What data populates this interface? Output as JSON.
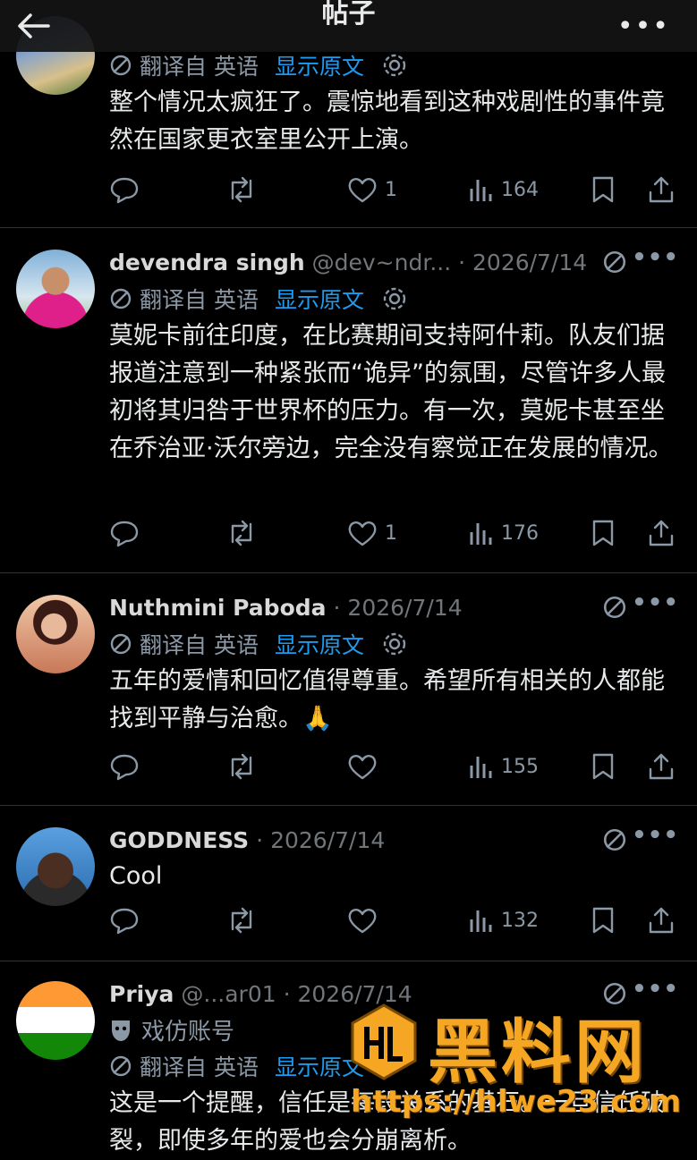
{
  "header": {
    "title": "帖子",
    "more_label": "•••"
  },
  "translate": {
    "label": "翻译自 英语",
    "show_original": "显示原文"
  },
  "posts": [
    {
      "name": "",
      "handle": "",
      "text": "整个情况太疯狂了。震惊地看到这种戏剧性的事件竟然在国家更衣室里公开上演。",
      "likes": "1",
      "views": "164"
    },
    {
      "name": "devendra singh",
      "handle": "@dev~ndr... · 2026/7/14",
      "text": "莫妮卡前往印度，在比赛期间支持阿什莉。队友们据报道注意到一种紧张而“诡异”的氛围，尽管许多人最初将其归咎于世界杯的压力。有一次，莫妮卡甚至坐在乔治亚·沃尔旁边，完全没有察觉正在发展的情况。",
      "likes": "1",
      "views": "176"
    },
    {
      "name": "Nuthmini Paboda",
      "handle": "· 2026/7/14",
      "text": "五年的爱情和回忆值得尊重。希望所有相关的人都能找到平静与治愈。🙏",
      "likes": "",
      "views": "155"
    },
    {
      "name": "GODDNESS",
      "handle": "· 2026/7/14",
      "text": "Cool",
      "likes": "",
      "views": "132"
    },
    {
      "name": "Priya",
      "handle": "@...ar01 · 2026/7/14",
      "parody": "戏仿账号",
      "text": "这是一个提醒，信任是每段关系的基石。一旦信任破裂，即使多年的爱也会分崩离析。",
      "likes": "",
      "views": ""
    }
  ],
  "watermark": {
    "brand": "黑料网",
    "url": "https://hlwe23.com"
  },
  "colors": {
    "accent": "#1d9bf0",
    "muted": "#8b98a5",
    "divider": "#2f3336",
    "watermark": "#f5a623"
  },
  "icons": [
    "back-arrow-icon",
    "more-icon",
    "no-translate-icon",
    "gear-icon",
    "reply-icon",
    "retweet-icon",
    "heart-icon",
    "views-icon",
    "bookmark-icon",
    "share-icon",
    "mask-icon"
  ]
}
